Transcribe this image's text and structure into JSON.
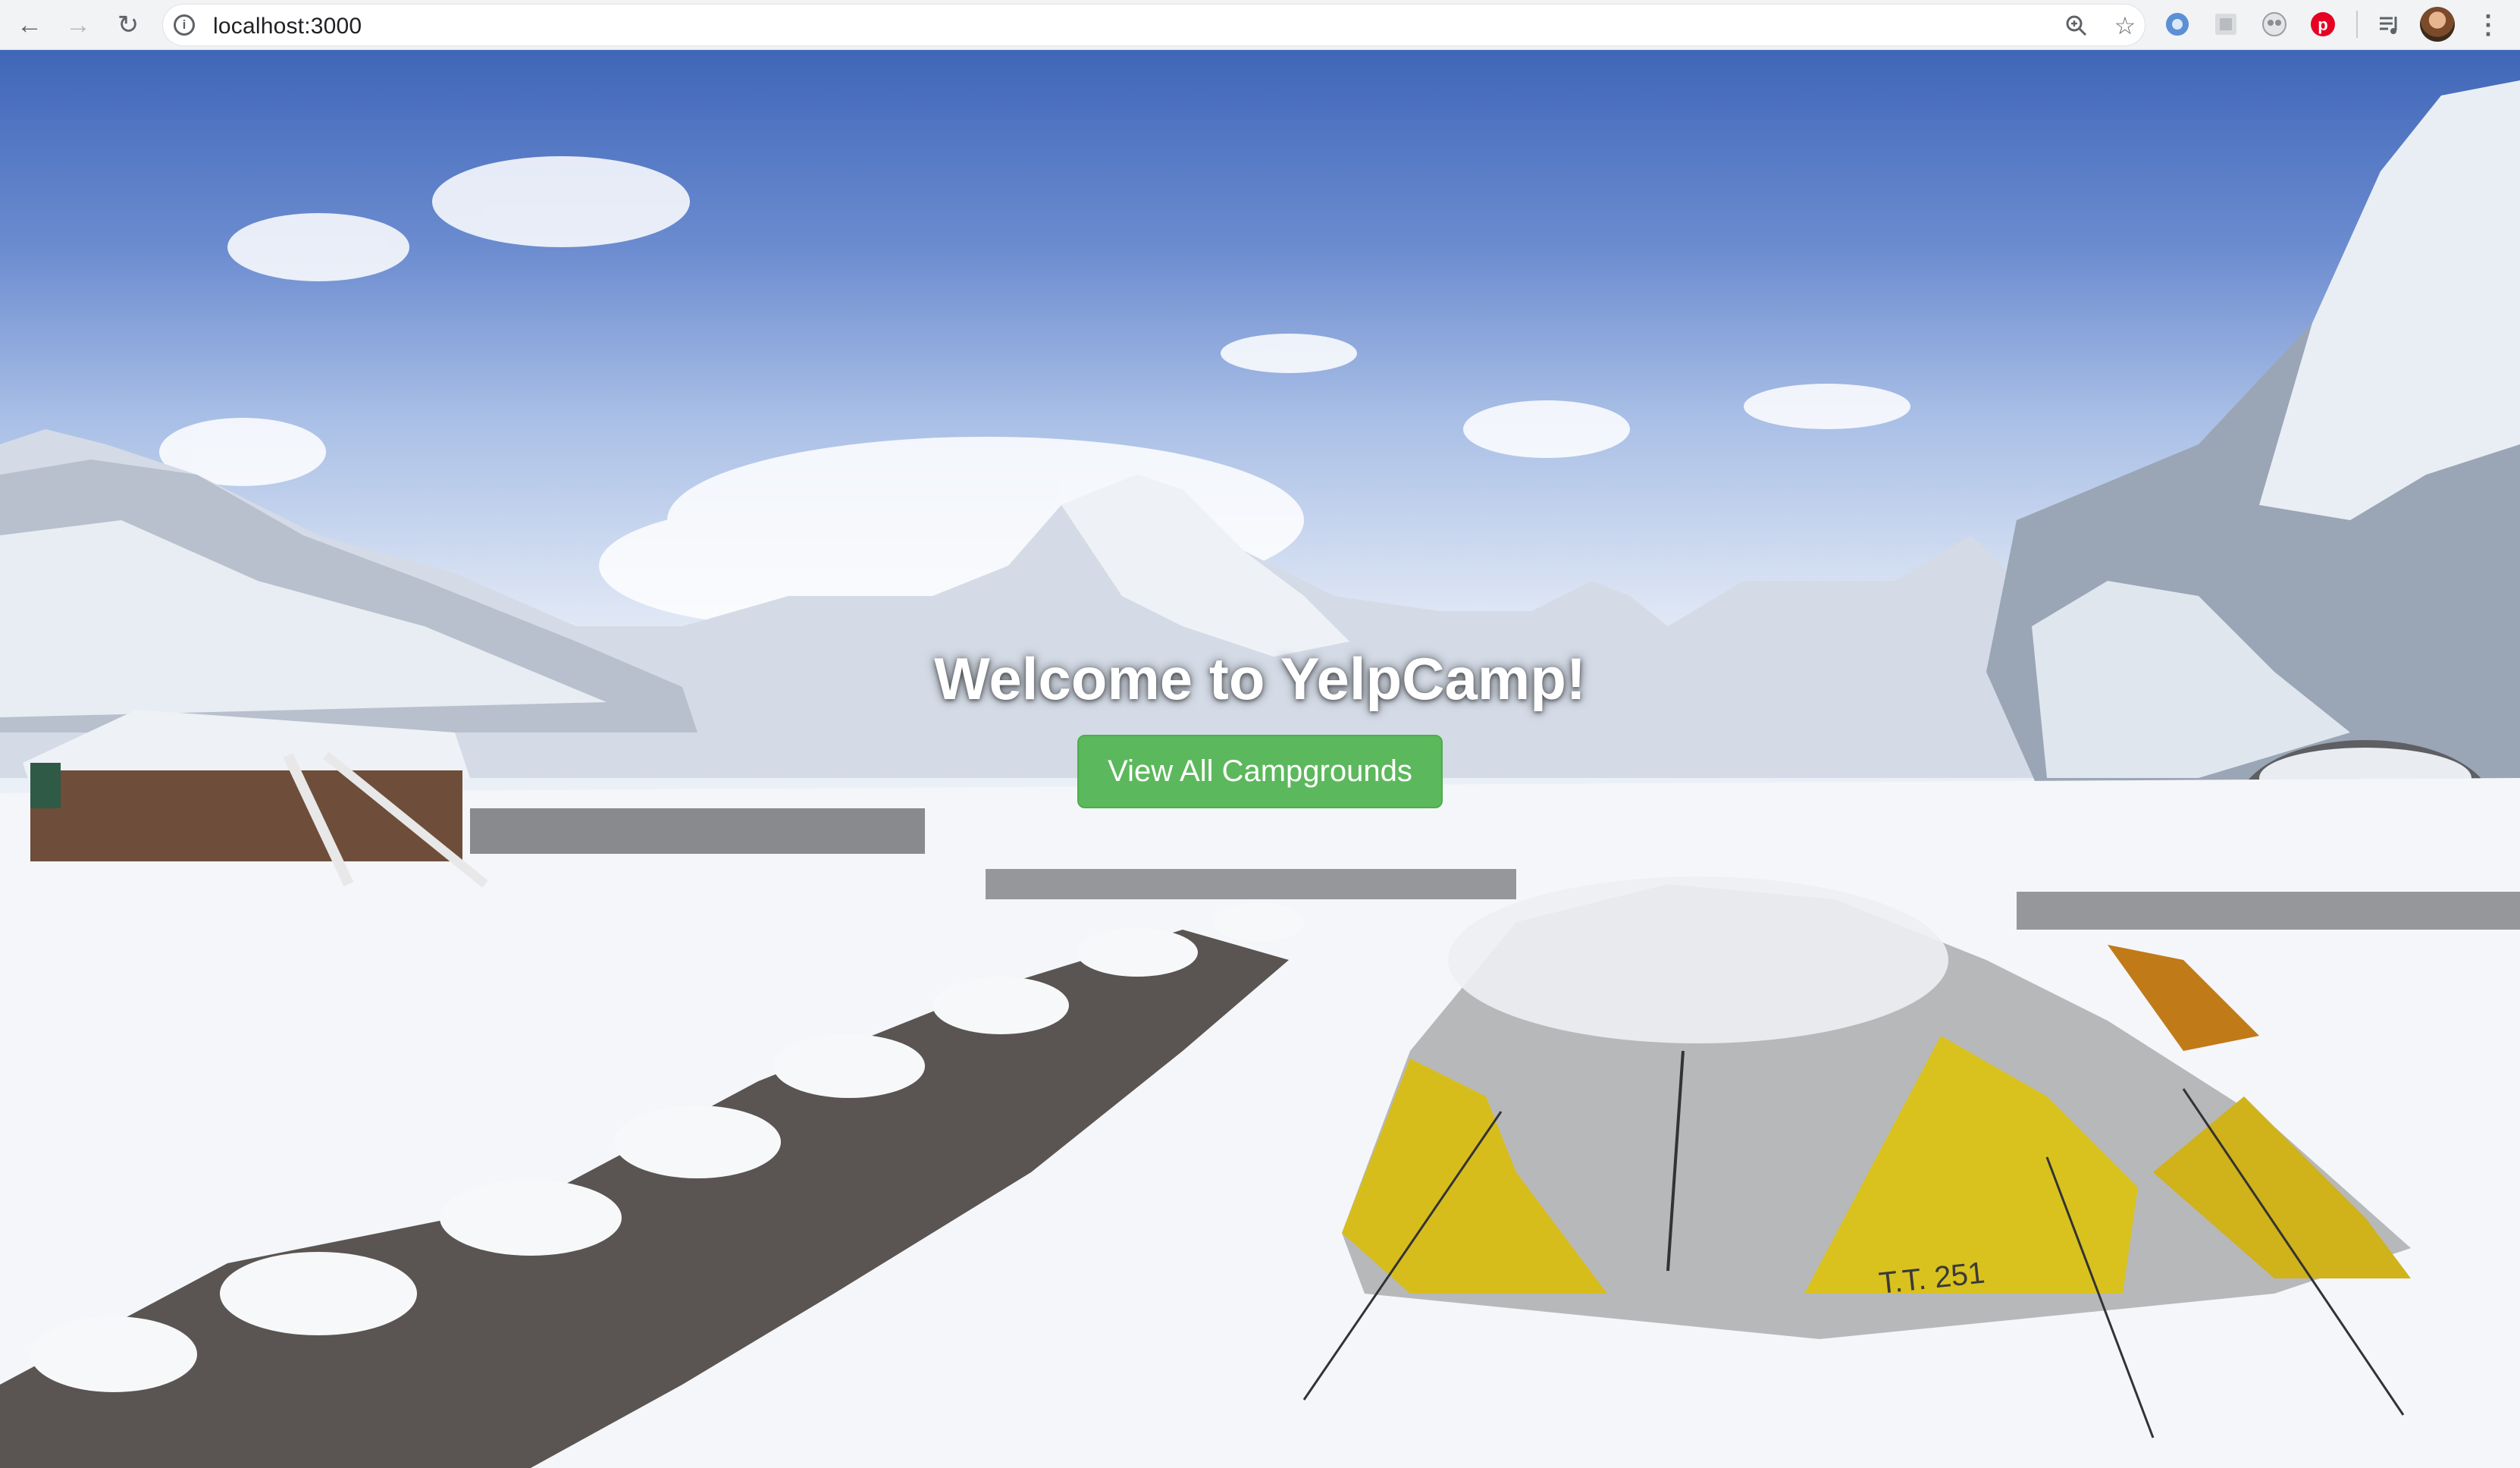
{
  "browser": {
    "url": "localhost:3000",
    "icons": {
      "back": "arrow-left-icon",
      "forward": "arrow-right-icon",
      "reload": "reload-icon",
      "site_info": "info-icon",
      "zoom": "zoom-icon",
      "bookmark": "star-icon",
      "extensions": [
        "blue-extension-icon",
        "gray-extension-icon",
        "owl-extension-icon",
        "pinterest-icon"
      ],
      "media": "media-controls-icon",
      "profile": "avatar",
      "menu": "kebab-menu-icon"
    }
  },
  "hero": {
    "title": "Welcome to YelpCamp!",
    "button_label": "View All Campgrounds",
    "button_color": "#5cb85c",
    "title_color": "#ffffff",
    "tent_text": "T.T. 251"
  }
}
